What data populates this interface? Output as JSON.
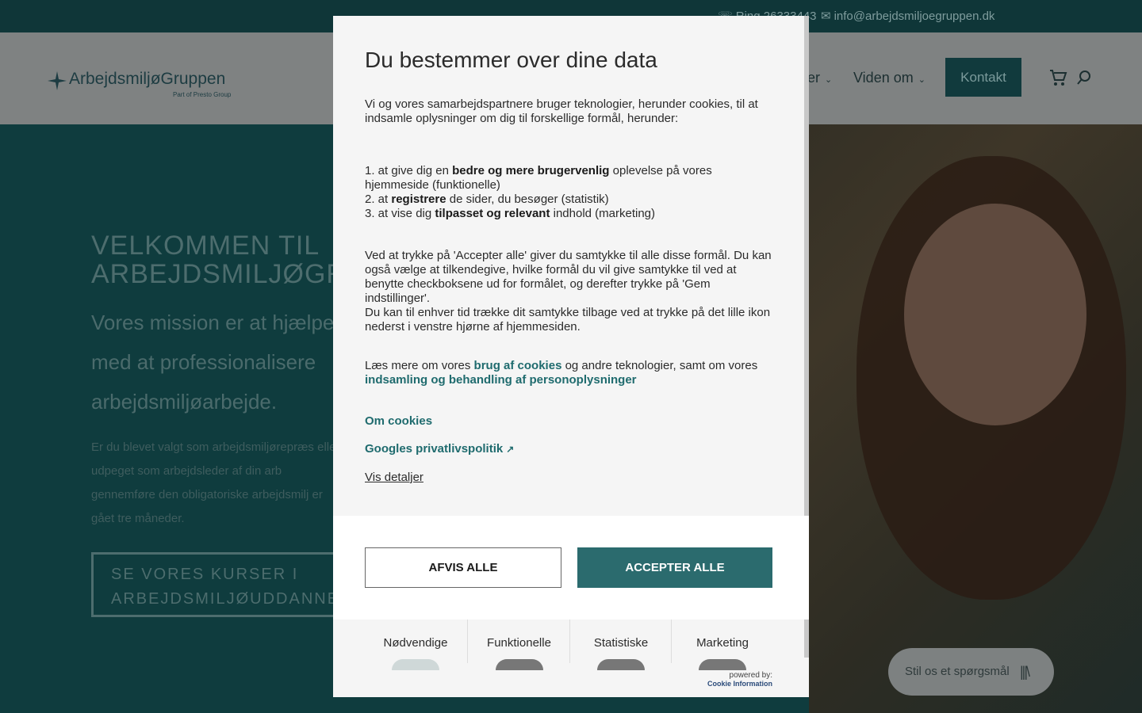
{
  "topbar": {
    "phone": "Ring 26333443",
    "email": "info@arbejdsmiljoegruppen.dk"
  },
  "header": {
    "logo_name": "ArbejdsmiljøGruppen",
    "logo_sub": "Part of Presto Group",
    "nav_partial": "er",
    "nav_viden": "Viden om",
    "contact": "Kontakt"
  },
  "hero": {
    "title_line1": "VELKOMMEN TIL",
    "title_line2": "ARBEJDSMILJØGR",
    "mission": "Vores mission er at hjælpe med at professionalisere arbejdsmiljøarbejde.",
    "desc": "Er du blevet valgt som arbejdsmiljørepræs eller udpeget som arbejdsleder af din arb gennemføre den obligatoriske arbejdsmilj er gået tre måneder.",
    "cta": "SE VORES KURSER I ARBEJDSMILJØUDDANNE"
  },
  "chat": {
    "label": "Stil os et spørgsmål"
  },
  "modal": {
    "title": "Du bestemmer over dine data",
    "intro": "Vi og vores samarbejdspartnere bruger teknologier, herunder cookies, til at indsamle oplysninger om dig til forskellige formål, herunder:",
    "item1_pre": "1. at give dig en ",
    "item1_bold": "bedre og mere brugervenlig",
    "item1_post": " oplevelse på vores hjemmeside (funktionelle)",
    "item2_pre": "2. at ",
    "item2_bold": "registrere",
    "item2_post": " de sider, du besøger (statistik)",
    "item3_pre": "3. at vise dig ",
    "item3_bold": "tilpasset og relevant",
    "item3_post": " indhold (marketing)",
    "consent1": "Ved at trykke på 'Accepter alle' giver du samtykke til alle disse formål. Du kan også vælge at tilkendegive, hvilke formål du vil give samtykke til ved at benytte checkboksene ud for formålet, og derefter trykke på 'Gem indstillinger'.",
    "consent2": "Du kan til enhver tid trække dit samtykke tilbage ved at trykke på det lille ikon nederst i venstre hjørne af hjemmesiden.",
    "read_pre": "Læs mere om vores ",
    "read_link1": "brug af cookies",
    "read_mid": " og andre teknologier, samt om vores ",
    "read_link2": "indsamling og behandling af personoplysninger",
    "om_cookies": "Om cookies",
    "google": "Googles privatlivspolitik",
    "vis": "Vis detaljer",
    "decline": "AFVIS ALLE",
    "accept": "ACCEPTER ALLE",
    "categories": [
      "Nødvendige",
      "Funktionelle",
      "Statistiske",
      "Marketing"
    ],
    "powered_by": "powered by:",
    "brand": "Cookie Information"
  },
  "colors": {
    "teal": "#2b6b6e",
    "link": "#1f6b6e"
  }
}
